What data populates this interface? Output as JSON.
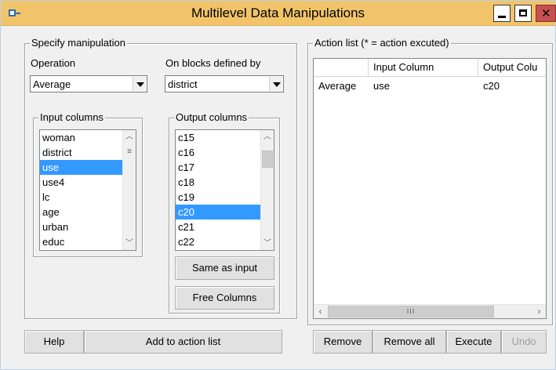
{
  "window": {
    "title": "Multilevel Data Manipulations"
  },
  "specify": {
    "legend": "Specify manipulation",
    "operation_label": "Operation",
    "operation_value": "Average",
    "blocks_label": "On blocks defined by",
    "blocks_value": "district",
    "input_legend": "Input columns",
    "input_items": [
      "woman",
      "district",
      "use",
      "use4",
      "lc",
      "age",
      "urban",
      "educ"
    ],
    "input_selected": "use",
    "output_legend": "Output columns",
    "output_items": [
      "c15",
      "c16",
      "c17",
      "c18",
      "c19",
      "c20",
      "c21",
      "c22"
    ],
    "output_selected": "c20",
    "same_as_input": "Same as input",
    "free_columns": "Free Columns"
  },
  "bottom_left": {
    "help": "Help",
    "add": "Add to action list"
  },
  "action_list": {
    "legend": "Action list (* = action excuted)",
    "columns": [
      "",
      "Input Column",
      "Output Colu"
    ],
    "rows": [
      {
        "op": "Average",
        "input": "use",
        "output": "c20"
      }
    ],
    "hscroll_grip": "III"
  },
  "actions": {
    "remove": "Remove",
    "remove_all": "Remove all",
    "execute": "Execute",
    "undo": "Undo"
  },
  "icons": {
    "app": "app-icon",
    "minimize": "minimize-icon",
    "maximize": "maximize-icon",
    "close": "close-icon"
  },
  "colors": {
    "titlebar": "#f2c46a",
    "selection": "#3399ff",
    "close_button": "#c75050"
  }
}
